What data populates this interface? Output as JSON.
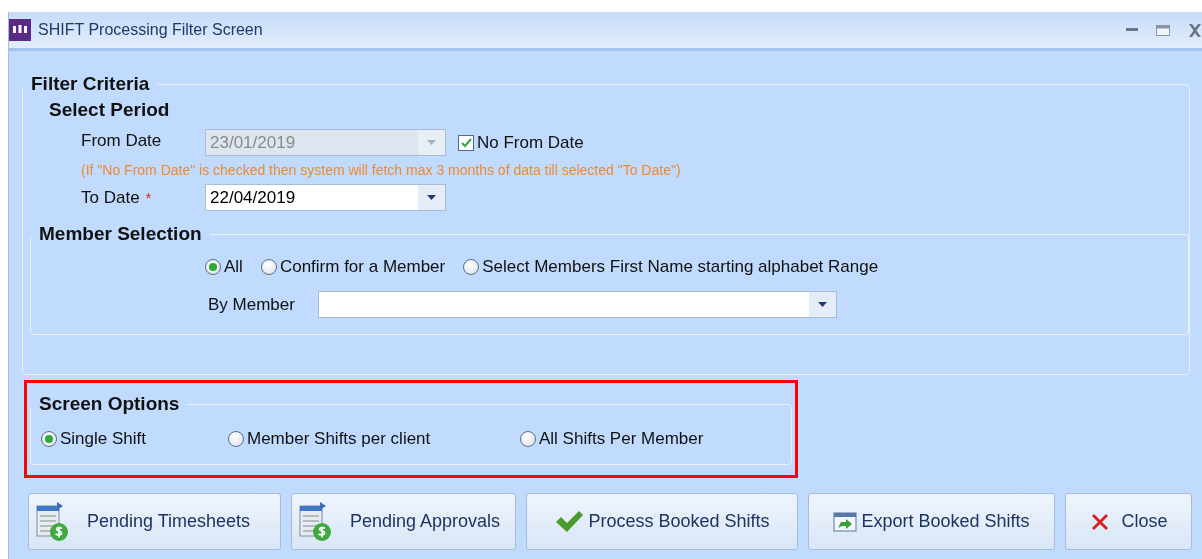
{
  "window": {
    "title": "SHIFT Processing Filter Screen"
  },
  "filter_criteria": {
    "title": "Filter Criteria",
    "select_period": {
      "title": "Select Period",
      "from_date": {
        "label": "From Date",
        "value": "23/01/2019",
        "disabled": true
      },
      "no_from_date": {
        "label": "No From Date",
        "checked": true
      },
      "note": "(If \"No From Date\" is checked then system will fetch max 3 months of data till selected \"To Date\")",
      "to_date": {
        "label": "To Date",
        "required_mark": "*",
        "value": "22/04/2019",
        "disabled": false
      }
    },
    "member_selection": {
      "title": "Member Selection",
      "options": [
        {
          "label": "All",
          "selected": true
        },
        {
          "label": "Confirm for a Member",
          "selected": false
        },
        {
          "label": "Select Members First Name starting alphabet Range",
          "selected": false
        }
      ],
      "by_member": {
        "label": "By Member"
      }
    }
  },
  "screen_options": {
    "title": "Screen Options",
    "highlighted": true,
    "options": [
      {
        "label": "Single Shift",
        "selected": true
      },
      {
        "label": "Member Shifts per client",
        "selected": false
      },
      {
        "label": "All Shifts Per Member",
        "selected": false
      }
    ]
  },
  "buttons": [
    {
      "label": "Pending Timesheets",
      "kind": "sheet"
    },
    {
      "label": "Pending Approvals",
      "kind": "sheet"
    },
    {
      "label": "Process Booked Shifts",
      "kind": "check"
    },
    {
      "label": "Export Booked Shifts",
      "kind": "export"
    },
    {
      "label": "Close",
      "kind": "close"
    }
  ]
}
